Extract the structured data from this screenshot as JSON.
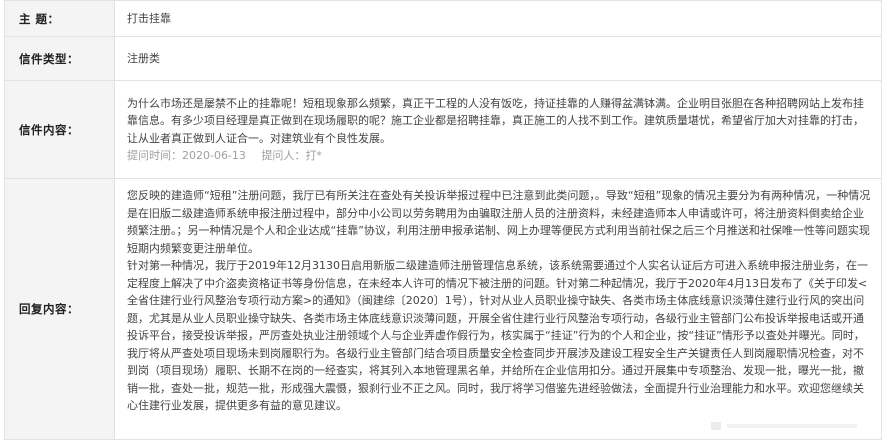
{
  "rows": {
    "subject": {
      "label": "主    题：",
      "value": "打击挂靠"
    },
    "type": {
      "label": "信件类型：",
      "value": "注册类"
    },
    "content": {
      "label": "信件内容：",
      "text": "为什么市场还是屡禁不止的挂靠呢！短租现象那么频繁，真正干工程的人没有饭吃，持证挂靠的人赚得盆满钵满。企业明目张胆在各种招聘网站上发布挂靠信息。有多少项目经理是真正做到在现场履职的呢？施工企业都是招聘挂靠，真正施工的人找不到工作。建筑质量堪忧，希望省厅加大对挂靠的打击，让从业者真正做到人证合一。对建筑业有个良性发展。",
      "time_label": "提问时间：",
      "time_value": "2020-06-13",
      "asker_label": "提问人：",
      "asker_value": "打*"
    },
    "reply": {
      "label": "回复内容：",
      "paragraphs": [
        "您反映的建造师“短租”注册问题，我厅已有所关注在查处有关投诉举报过程中已注意到此类问题，。导致“短租”现象的情况主要分为有两种情况，一种情况是在旧版二级建造师系统申报注册过程中，部分中小公司以劳务聘用为由骗取注册人员的注册资料，未经建造师本人申请或许可，将注册资料倒卖给企业频繁注册。；另一种情况是个人和企业达成“挂靠”协议，利用注册申报承诺制、网上办理等便民方式利用当前社保之后三个月推送和社保唯一性等问题实现短期内频繁变更注册单位。",
        "针对第一种情况，我厅于2019年12月3130日启用新版二级建造师注册管理信息系统，该系统需要通过个人实名认证后方可进入系统申报注册业务，在一定程度上解决了中介盗卖资格证书等身份信息，在未经本人许可的情况下被注册的问题。针对第二种起情况，我厅于2020年4月13日发布了《关于印发<全省住建行业行风整治专项行动方案>的通知》（闽建综〔2020〕1号），针对从业人员职业操守缺失、各类市场主体底线意识淡薄住建行业行风的突出问题，尤其是从业人员职业操守缺失、各类市场主体底线意识淡薄问题，开展全省住建行业行风整治专项行动，各级行业主管部门公布投诉举报电话或开通投诉平台，接受投诉举报，严厉查处执业注册领域个人与企业弄虚作假行为，核实属于“挂证”行为的个人和企业，按“挂证”情形予以查处并曝光。同时，我厅将从严查处项目现场未到岗履职行为。各级行业主管部门结合项目质量安全检查同步开展涉及建设工程安全生产关键责任人到岗履职情况检查，对不到岗（项目现场）履职、长期不在岗的一经查实，将其列入本地管理黑名单，并给所在企业信用扣分。通过开展集中专项整治、发现一批，曝光一批，撤销一批，查处一批，规范一批，形成强大震慑，狠刹行业不正之风。同时，我厅将学习借鉴先进经验做法，全面提升行业治理能力和水平。欢迎您继续关心住建行业发展，提供更多有益的意见建议。"
      ]
    }
  }
}
